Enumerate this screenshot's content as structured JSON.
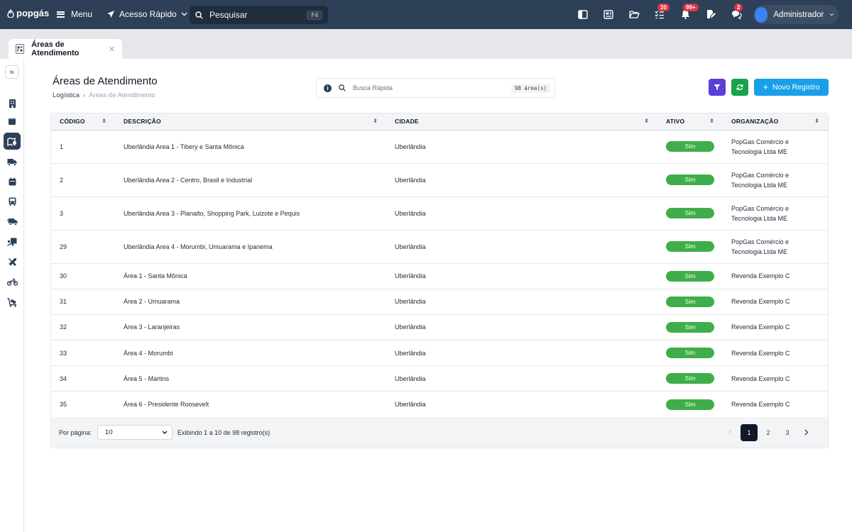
{
  "topbar": {
    "logo_text": "popgás",
    "menu_label": "Menu",
    "quick_access_label": "Acesso Rápido",
    "search_placeholder": "Pesquisar",
    "search_shortcut": "F4",
    "badges": {
      "tasks": "20",
      "notifications": "99+",
      "messages": "2"
    },
    "user_name": "Administrador"
  },
  "tab": {
    "label": "Áreas de Atendimento"
  },
  "page": {
    "title": "Áreas de Atendimento",
    "breadcrumb": {
      "parent": "Logística",
      "separator": "›",
      "current": "Áreas de Atendimento"
    },
    "quick_search_placeholder": "Busca Rápida",
    "count_label": "98 área(s)",
    "new_button_label": "Novo Registro"
  },
  "table": {
    "columns": {
      "code": "CÓDIGO",
      "description": "DESCRIÇÃO",
      "city": "CIDADE",
      "active": "ATIVO",
      "organization": "ORGANIZAÇÃO"
    },
    "rows": [
      {
        "code": "1",
        "description": "Uberlândia Area 1 - Tibery e Santa Mônica",
        "city": "Uberlândia",
        "active": "Sim",
        "org_line1": "PopGas Comércio e",
        "org_line2": "Tecnologia Ltda ME"
      },
      {
        "code": "2",
        "description": "Uberlândia Area 2 - Centro, Brasil e Industrial",
        "city": "Uberlândia",
        "active": "Sim",
        "org_line1": "PopGas Comércio e",
        "org_line2": "Tecnologia Ltda ME"
      },
      {
        "code": "3",
        "description": "Uberlândia Area 3 - Planalto, Shopping Park, Luizote e Pequis",
        "city": "Uberlândia",
        "active": "Sim",
        "org_line1": "PopGas Comércio e",
        "org_line2": "Tecnologia Ltda ME"
      },
      {
        "code": "29",
        "description": "Uberlândia Area 4 - Morumbi, Umuarama e Ipanema",
        "city": "Uberlândia",
        "active": "Sim",
        "org_line1": "PopGas Comércio e",
        "org_line2": "Tecnologia Ltda ME"
      },
      {
        "code": "30",
        "description": "Área 1 - Santa Mônica",
        "city": "Uberlândia",
        "active": "Sim",
        "org_line1": "Revenda Exemplo C",
        "org_line2": ""
      },
      {
        "code": "31",
        "description": "Área 2 - Umuarama",
        "city": "Uberlândia",
        "active": "Sim",
        "org_line1": "Revenda Exemplo C",
        "org_line2": ""
      },
      {
        "code": "32",
        "description": "Área 3 - Laranjeiras",
        "city": "Uberlândia",
        "active": "Sim",
        "org_line1": "Revenda Exemplo C",
        "org_line2": ""
      },
      {
        "code": "33",
        "description": "Área 4 - Morumbi",
        "city": "Uberlândia",
        "active": "Sim",
        "org_line1": "Revenda Exemplo C",
        "org_line2": ""
      },
      {
        "code": "34",
        "description": "Área 5 - Martins",
        "city": "Uberlândia",
        "active": "Sim",
        "org_line1": "Revenda Exemplo C",
        "org_line2": ""
      },
      {
        "code": "35",
        "description": "Área 6 - Presidente Roosevelt",
        "city": "Uberlândia",
        "active": "Sim",
        "org_line1": "Revenda Exemplo C",
        "org_line2": ""
      }
    ]
  },
  "pagination": {
    "per_page_label": "Por página:",
    "per_page_value": "10",
    "showing_text": "Exibindo 1 a 10 de 98 registro(s)",
    "pages": [
      "1",
      "2",
      "3"
    ],
    "current_page": "1"
  },
  "icons": {
    "sidebar": [
      "building-icon",
      "box-icon",
      "map-location-icon",
      "truck-icon",
      "calendar-icon",
      "bus-icon",
      "truck-fast-icon",
      "truck-ramp-icon",
      "tools-icon",
      "motorcycle-icon",
      "cart-flatbed-icon"
    ]
  },
  "colors": {
    "topbar": "#2e4057",
    "accent_blue": "#1aa0e8",
    "filter_purple": "#5b3fd9",
    "refresh_green": "#16a34a",
    "active_pill": "#3fae4a",
    "badge_red": "#dc3545"
  }
}
